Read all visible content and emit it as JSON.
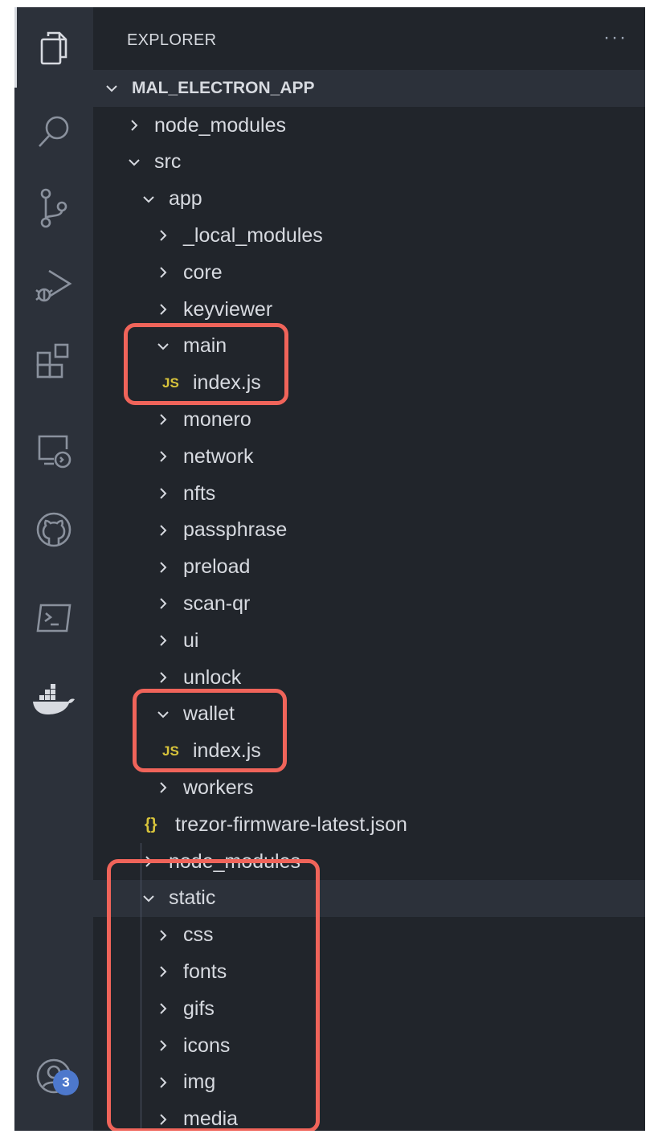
{
  "activity_bar": {
    "items": [
      {
        "icon": "files-icon"
      },
      {
        "icon": "search-icon"
      },
      {
        "icon": "source-control-icon"
      },
      {
        "icon": "run-debug-icon"
      },
      {
        "icon": "extensions-icon"
      },
      {
        "icon": "remote-explorer-icon"
      },
      {
        "icon": "github-icon"
      },
      {
        "icon": "terminal-icon"
      },
      {
        "icon": "docker-icon"
      }
    ],
    "accounts_badge": "3"
  },
  "sidebar": {
    "title": "EXPLORER",
    "more_actions": "···",
    "root": "MAL_ELECTRON_APP",
    "tree": [
      {
        "label": "node_modules",
        "type": "folder",
        "expanded": false
      },
      {
        "label": "src",
        "type": "folder",
        "expanded": true
      },
      {
        "label": "app",
        "type": "folder",
        "expanded": true
      },
      {
        "label": "_local_modules",
        "type": "folder",
        "expanded": false
      },
      {
        "label": "core",
        "type": "folder",
        "expanded": false
      },
      {
        "label": "keyviewer",
        "type": "folder",
        "expanded": false
      },
      {
        "label": "main",
        "type": "folder",
        "expanded": true
      },
      {
        "label": "index.js",
        "type": "js",
        "icon_text": "JS"
      },
      {
        "label": "monero",
        "type": "folder",
        "expanded": false
      },
      {
        "label": "network",
        "type": "folder",
        "expanded": false
      },
      {
        "label": "nfts",
        "type": "folder",
        "expanded": false
      },
      {
        "label": "passphrase",
        "type": "folder",
        "expanded": false
      },
      {
        "label": "preload",
        "type": "folder",
        "expanded": false
      },
      {
        "label": "scan-qr",
        "type": "folder",
        "expanded": false
      },
      {
        "label": "ui",
        "type": "folder",
        "expanded": false
      },
      {
        "label": "unlock",
        "type": "folder",
        "expanded": false
      },
      {
        "label": "wallet",
        "type": "folder",
        "expanded": true
      },
      {
        "label": "index.js",
        "type": "js",
        "icon_text": "JS"
      },
      {
        "label": "workers",
        "type": "folder",
        "expanded": false
      },
      {
        "label": "trezor-firmware-latest.json",
        "type": "json",
        "icon_text": "{}"
      },
      {
        "label": "node_modules",
        "type": "folder",
        "expanded": false
      },
      {
        "label": "static",
        "type": "folder",
        "expanded": true,
        "selected": true
      },
      {
        "label": "css",
        "type": "folder",
        "expanded": false
      },
      {
        "label": "fonts",
        "type": "folder",
        "expanded": false
      },
      {
        "label": "gifs",
        "type": "folder",
        "expanded": false
      },
      {
        "label": "icons",
        "type": "folder",
        "expanded": false
      },
      {
        "label": "img",
        "type": "folder",
        "expanded": false
      },
      {
        "label": "media",
        "type": "folder",
        "expanded": false
      }
    ]
  },
  "colors": {
    "highlight": "#f0645a",
    "js_icon": "#d8c43b",
    "badge": "#4d78cc"
  }
}
